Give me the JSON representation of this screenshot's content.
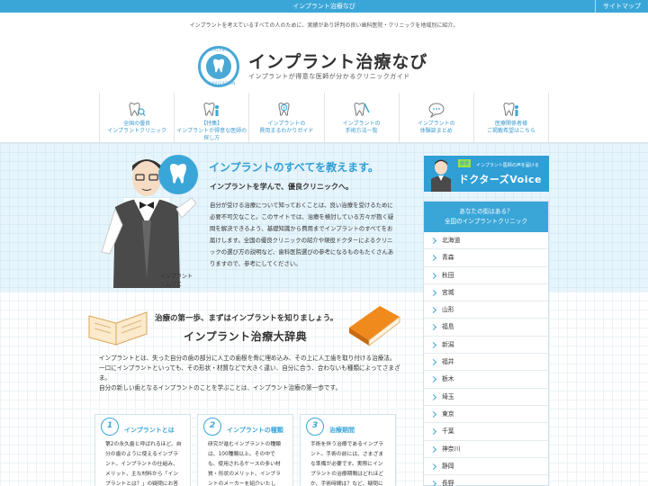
{
  "topbar": {
    "title": "インプラント治療なび",
    "sitemap": "サイトマップ"
  },
  "header": {
    "tagline": "インプラントを考えているすべての人のために、実績があり評判の良い歯科医院・クリニックを地域別に紹介。",
    "logo_title": "インプラント治療なび",
    "logo_subtitle": "インプラントが得意な医師が分かるクリニックガイド",
    "logo_ring_text": "IMPLANT",
    "logo_ring_text_b": "NAVIGATION"
  },
  "nav": [
    {
      "label": "全国の優良\nインプラントクリニック",
      "icon": "tooth-search-icon"
    },
    {
      "label": "【特集】\nインプラントが得意な医師の\n探し方",
      "icon": "tooth-doctor-icon"
    },
    {
      "label": "インプラントの\n費用まるわかりガイド",
      "icon": "tooth-yen-icon"
    },
    {
      "label": "インプラントの\n手術方法一覧",
      "icon": "tooth-tool-icon"
    },
    {
      "label": "インプラントの\n体験談まとめ",
      "icon": "speech-bubble-icon"
    },
    {
      "label": "医療関係者様\nご掲載希望はこちら",
      "icon": "tooth-staff-icon"
    }
  ],
  "hero": {
    "title": "インプラントのすべてを教えます。",
    "subtitle": "インプラントを学んで、優良クリニックへ。",
    "body": "自分が受ける治療について知っておくことは、良い治療を受けるために必要不可欠なこと。このサイトでは、治療を検討している方々が抱く疑問を解決できるよう、基礎知識から費用までインプラントのすべてをお届けします。全国の優良クリニックの紹介や現役ドクターによるクリニックの選び方の説明など、歯科医院選びの参考になるものもたくさんありますので、参考にしてください。",
    "caption": "インプラント\nソムリエ"
  },
  "section": {
    "lead": "治療の第一歩、まずはインプラントを知りましょう。",
    "title": "インプラント治療大辞典",
    "body1": "インプラントとは、失った自分の歯の部分に人工の歯根を骨に埋め込み、その上に人工歯を取り付ける治療法。",
    "body2": "一口にインプラントといっても、その形状・材質などで大きく違い、自分に合う、合わないも種類によってさまざま。",
    "body3": "自分の新しい歯となるインプラントのことを学ぶことは、インプラント治療の第一歩です。"
  },
  "cards": [
    {
      "num": "1",
      "title": "インプラントとは",
      "body": "第2の永久歯と呼ばれるほど、自分の歯のように使えるインプラント。インプラントの仕組み、メリット、主な材料から「インプラントとは？」の疑問にお答えしま"
    },
    {
      "num": "2",
      "title": "インプラントの種類",
      "body": "研究が進むインプラントの種類は、100種類以上。その中でも、使用されるケースの多い材質・形状のメリット、インプラントのメーカーを紹介いたし"
    },
    {
      "num": "3",
      "title": "治療期間",
      "body": "手術を伴う治療であるインプラント。手術の前には、さまざまな準備が必要です。実際にインプラントの治療期間はどれほどか、手術時間は？など、疑問にお答えしま"
    }
  ],
  "banner": {
    "tag": "厳選",
    "tag2": "インプラント医師の声を届ける",
    "title": "ドクターズVoice"
  },
  "region": {
    "head1": "あなたの街はある？",
    "head2": "全国のインプラントクリニック",
    "items": [
      "北海道",
      "青森",
      "秋田",
      "宮城",
      "山形",
      "福島",
      "新潟",
      "福井",
      "栃木",
      "埼玉",
      "東京",
      "千葉",
      "神奈川",
      "静岡",
      "長野"
    ]
  },
  "colors": {
    "accent": "#3aa6d8",
    "hero_bg": "#e6f4fb",
    "orange": "#f08a1c"
  }
}
